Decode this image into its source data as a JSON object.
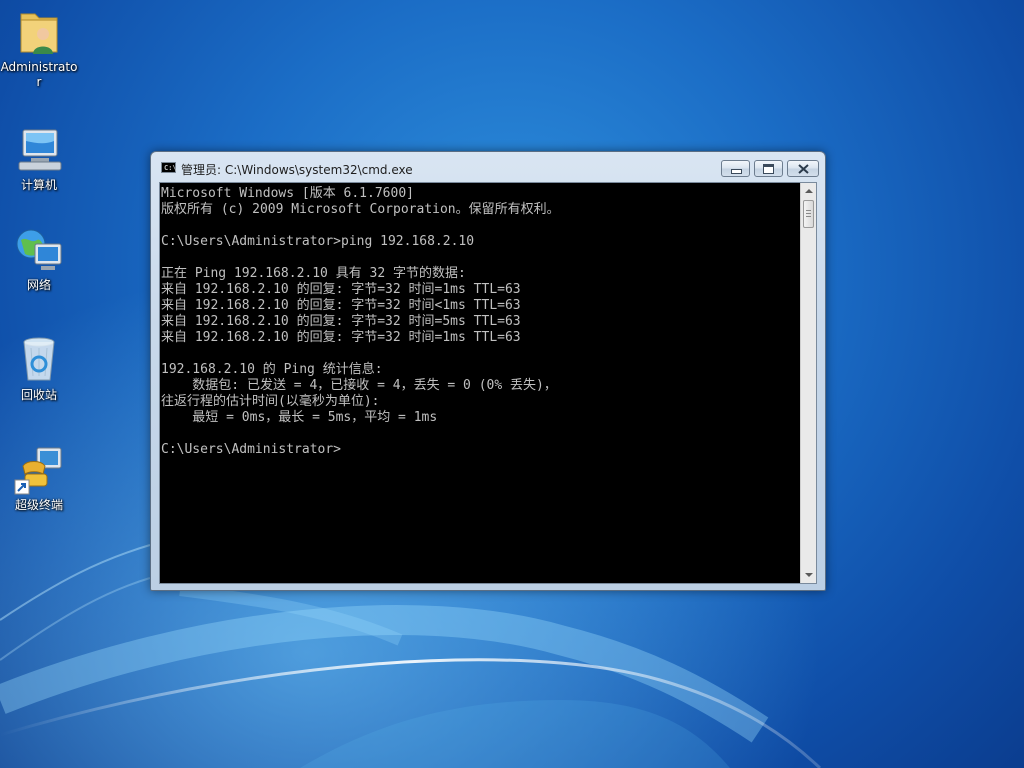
{
  "desktop": {
    "icons": [
      {
        "label": "Administrator",
        "icon": "user-folder-icon"
      },
      {
        "label": "计算机",
        "icon": "computer-icon"
      },
      {
        "label": "网络",
        "icon": "network-icon"
      },
      {
        "label": "回收站",
        "icon": "recycle-bin-icon"
      },
      {
        "label": "超级终端",
        "icon": "hyperterminal-shortcut-icon"
      }
    ]
  },
  "window": {
    "title": "管理员: C:\\Windows\\system32\\cmd.exe",
    "icon": "cmd-icon",
    "controls": {
      "minimize": "minimize-icon",
      "maximize": "maximize-icon",
      "close": "close-icon"
    },
    "console_lines": [
      "Microsoft Windows [版本 6.1.7600]",
      "版权所有 (c) 2009 Microsoft Corporation。保留所有权利。",
      "",
      "C:\\Users\\Administrator>ping 192.168.2.10",
      "",
      "正在 Ping 192.168.2.10 具有 32 字节的数据:",
      "来自 192.168.2.10 的回复: 字节=32 时间=1ms TTL=63",
      "来自 192.168.2.10 的回复: 字节=32 时间<1ms TTL=63",
      "来自 192.168.2.10 的回复: 字节=32 时间=5ms TTL=63",
      "来自 192.168.2.10 的回复: 字节=32 时间=1ms TTL=63",
      "",
      "192.168.2.10 的 Ping 统计信息:",
      "    数据包: 已发送 = 4，已接收 = 4，丢失 = 0 (0% 丢失)，",
      "往返行程的估计时间(以毫秒为单位):",
      "    最短 = 0ms，最长 = 5ms，平均 = 1ms",
      "",
      "C:\\Users\\Administrator>"
    ]
  },
  "colors": {
    "console_bg": "#000000",
    "console_fg": "#c0c0c0",
    "desktop_bg": "#1b6dc6"
  }
}
